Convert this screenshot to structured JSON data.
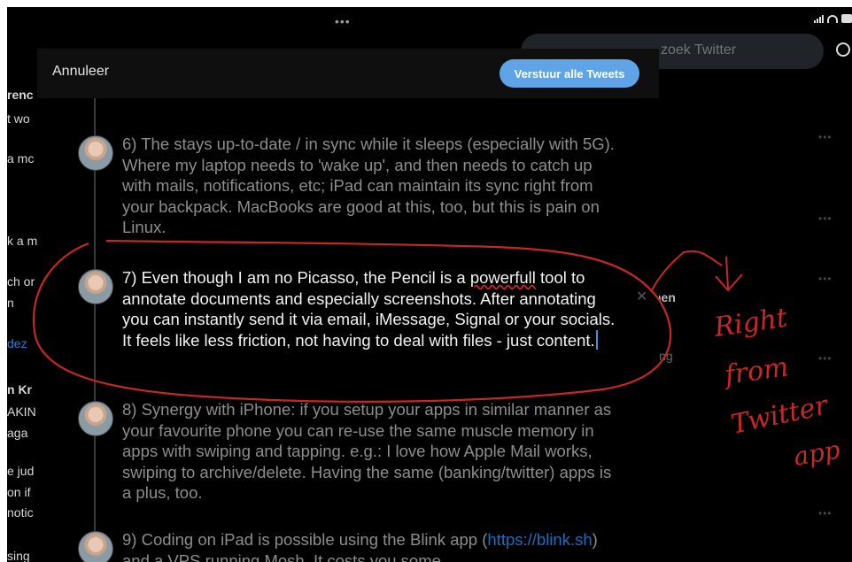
{
  "status_bar": {
    "dots": "•••"
  },
  "background": {
    "left_fragments": [
      "renc",
      "t wo",
      "a mc",
      "k a m",
      "ch or",
      "n",
      "dez",
      "n Kr",
      "AKIN",
      "aga",
      "e jud",
      "on if",
      "notic",
      "sing"
    ],
    "search_placeholder": "zoek Twitter",
    "side_fragments": [
      "hen",
      "ing"
    ]
  },
  "composer": {
    "cancel_label": "Annuleer",
    "send_all_label": "Verstuur alle Tweets",
    "tweets": [
      {
        "text": "6) The stays up-to-date / in sync while it sleeps (especially with 5G). Where my laptop needs to 'wake up', and then needs to catch up with mails, notifications, etc; iPad can maintain its sync right from your backpack. MacBooks are good at this, too, but this is pain on Linux."
      },
      {
        "text_before": "7) Even though I am no Picasso, the Pencil is a ",
        "underlined": "powerfull",
        "text_after": " tool to annotate documents and especially screenshots. After annotating you can instantly send it via email, iMessage, Signal or your socials. It feels like less friction, not having to deal with files - just content."
      },
      {
        "text": "8) Synergy with iPhone: if you setup your apps in similar manner as your favourite phone you can re-use the same muscle memory in apps with swiping and tapping. e.g.: I love how Apple Mail works, swiping to archive/delete. Having the same (banking/twitter) apps is a plus, too."
      },
      {
        "text_before": "9) Coding on iPad is possible using the Blink app (",
        "link": "https://blink.sh",
        "text_after": ") and a VPS running Mosh. It costs you some"
      }
    ]
  },
  "annotation": {
    "lines": [
      "Right",
      "from",
      "Twitter",
      "app"
    ],
    "color": "#c62828"
  }
}
